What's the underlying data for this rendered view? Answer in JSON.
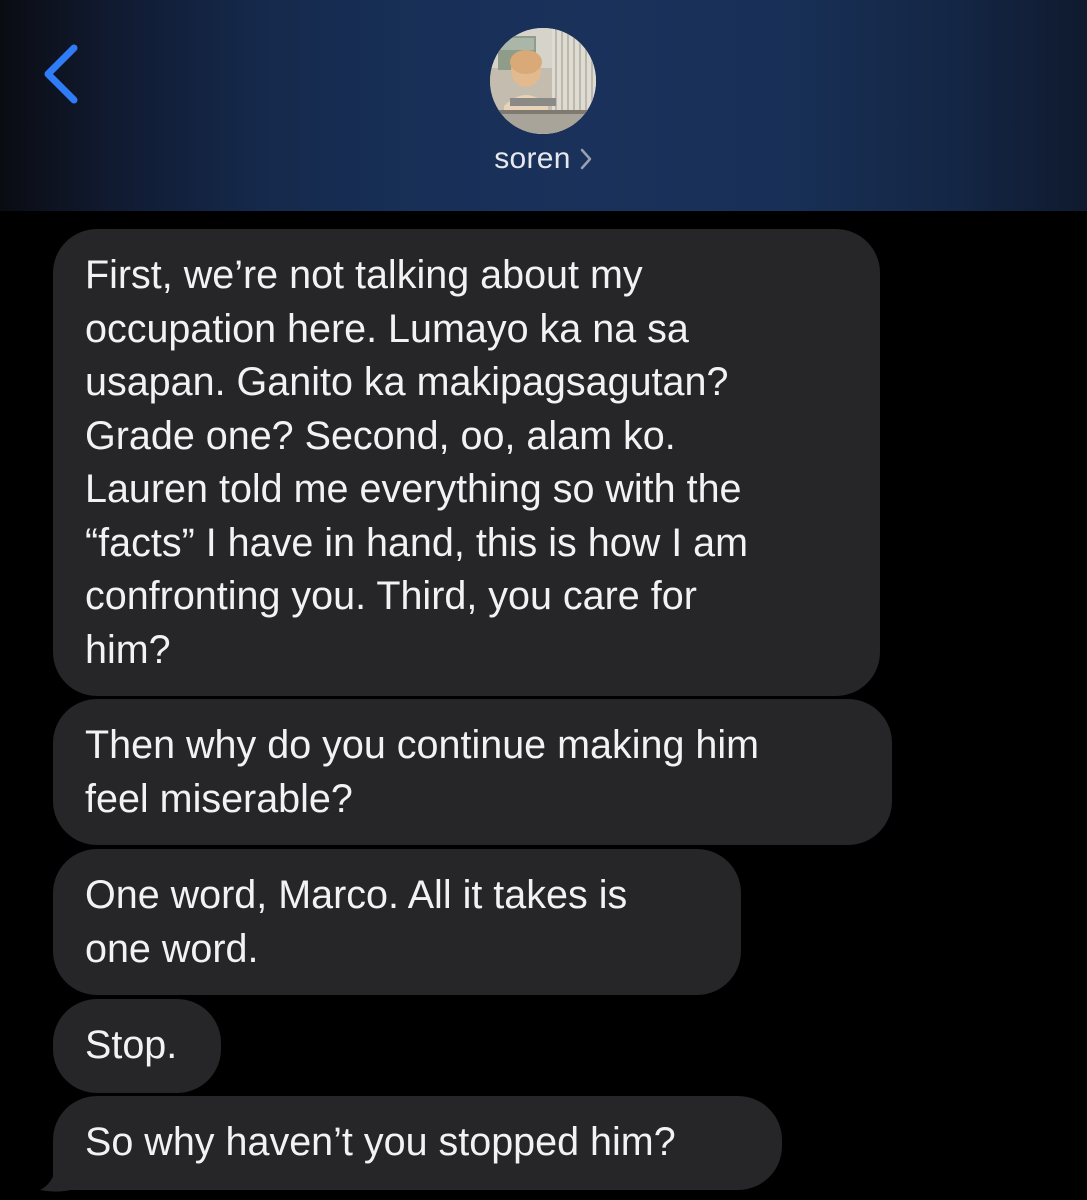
{
  "header": {
    "contact_name": "soren",
    "back_icon": "chevron-left-icon",
    "name_chevron_icon": "chevron-right-icon",
    "avatar": "contact-photo",
    "colors": {
      "accent": "#2f7cf6",
      "header_background": "#1a325b"
    }
  },
  "messages": [
    {
      "text": "First, we’re not talking about my\noccupation here. Lumayo ka na sa\nusapan. Ganito ka makipagsagutan?\nGrade one? Second, oo, alam ko.\nLauren told me everything so with the\n“facts” I have in hand, this is how I am\nconfronting you. Third, you care for\nhim?"
    },
    {
      "text": "Then why do you continue making him\nfeel miserable?"
    },
    {
      "text": "One word, Marco. All it takes is\none word."
    },
    {
      "text": "Stop."
    },
    {
      "text": "So why haven’t you stopped him?"
    }
  ],
  "colors": {
    "bubble_received": "#262629",
    "message_text": "#f2f2f4",
    "background": "#000000"
  }
}
